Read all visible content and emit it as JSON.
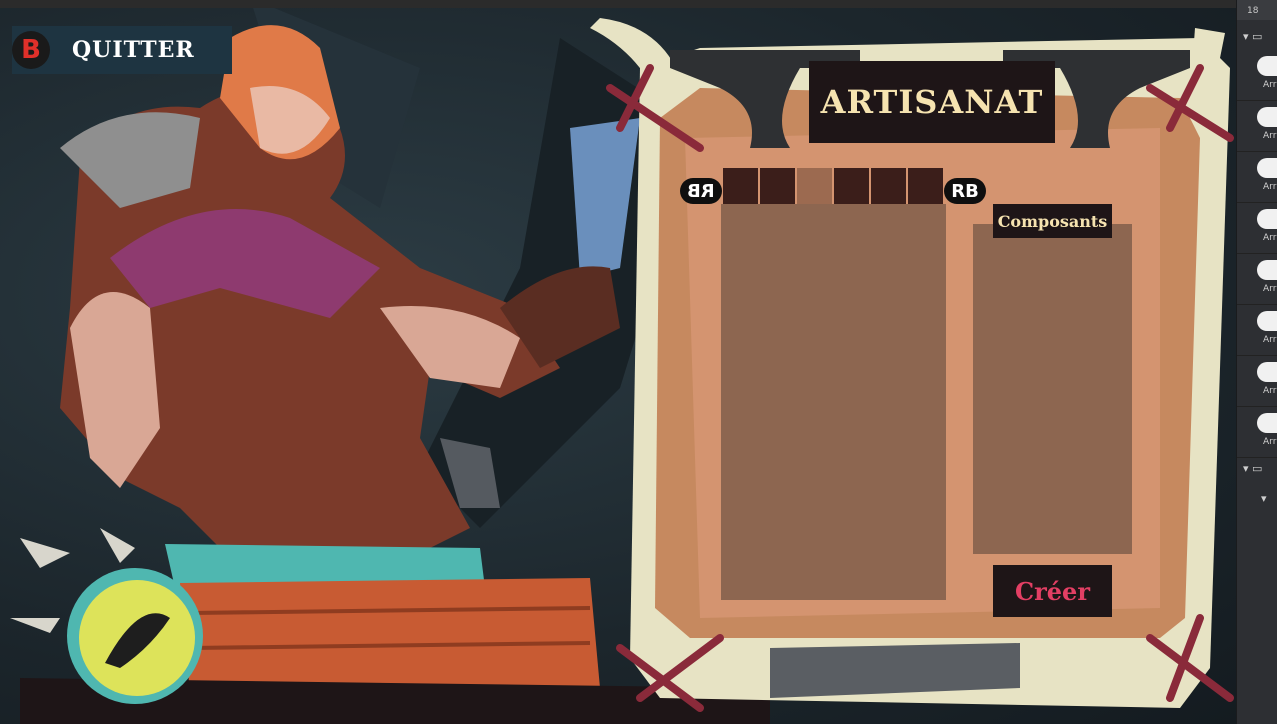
{
  "quit": {
    "key": "B",
    "label": "QUITTER"
  },
  "crafting": {
    "title": "ARTISANAT",
    "left_bumper": "RB",
    "right_bumper": "RB",
    "components_label": "Composants",
    "create_button": "Créer",
    "active_tab_index": 3
  },
  "editor_panel": {
    "header": "18",
    "item_label": "Arr"
  },
  "colors": {
    "panel_dark": "#1e1517",
    "title_text": "#f6e3b0",
    "create_text": "#e33f64",
    "list_bg": "#8d6650",
    "parchment": "#c6895f"
  }
}
